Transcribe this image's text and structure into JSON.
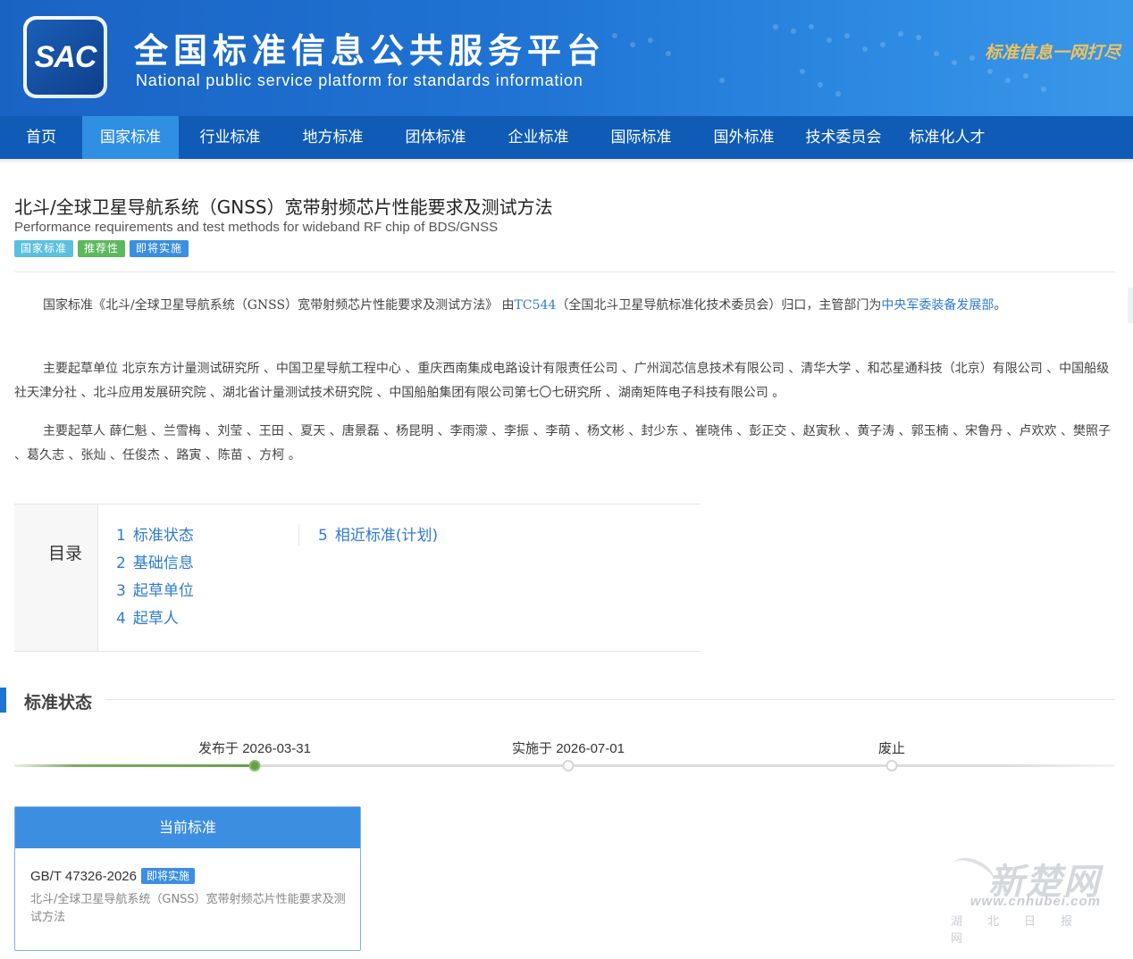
{
  "header": {
    "logo_text": "SAC",
    "title": "全国标准信息公共服务平台",
    "subtitle": "National public service platform  for standards information",
    "slogan": "标准信息一网打尽"
  },
  "nav": {
    "items": [
      {
        "label": "首页",
        "active": false
      },
      {
        "label": "国家标准",
        "active": true
      },
      {
        "label": "行业标准",
        "active": false
      },
      {
        "label": "地方标准",
        "active": false
      },
      {
        "label": "团体标准",
        "active": false
      },
      {
        "label": "企业标准",
        "active": false
      },
      {
        "label": "国际标准",
        "active": false
      },
      {
        "label": "国外标准",
        "active": false
      },
      {
        "label": "技术委员会",
        "active": false
      },
      {
        "label": "标准化人才",
        "active": false
      }
    ]
  },
  "standard": {
    "title": "北斗/全球卫星导航系统（GNSS）宽带射频芯片性能要求及测试方法",
    "title_en": "Performance requirements and test methods for wideband RF chip of BDS/GNSS",
    "tags": [
      "国家标准",
      "推荐性",
      "即将实施"
    ],
    "intro": {
      "prefix": "国家标准《北斗/全球卫星导航系统（GNSS）宽带射频芯片性能要求及测试方法》 由",
      "committee_link": "TC544",
      "middle": "（全国北斗卫星导航标准化技术委员会）归口，主管部门为",
      "dept_link": "中央军委装备发展部",
      "suffix": "。"
    },
    "drafting_units": "主要起草单位 北京东方计量测试研究所 、中国卫星导航工程中心 、重庆西南集成电路设计有限责任公司 、广州润芯信息技术有限公司 、清华大学 、和芯星通科技（北京）有限公司 、中国船级社天津分社 、北斗应用发展研究院 、湖北省计量测试技术研究院 、中国船舶集团有限公司第七〇七研究所 、湖南矩阵电子科技有限公司 。",
    "drafters": "主要起草人 薛仁魁 、兰雪梅 、刘莹 、王田 、夏天 、唐景磊 、杨昆明 、李雨濛 、李振 、李萌 、杨文彬 、封少东 、崔晓伟 、彭正交 、赵寅秋 、黄子涛 、郭玉楠 、宋鲁丹 、卢欢欢 、樊照子 、葛久志 、张灿 、任俊杰 、路寅 、陈苗 、方柯 。"
  },
  "toc": {
    "label": "目录",
    "col1": [
      {
        "num": "1",
        "label": "标准状态"
      },
      {
        "num": "2",
        "label": "基础信息"
      },
      {
        "num": "3",
        "label": "起草单位"
      },
      {
        "num": "4",
        "label": "起草人"
      }
    ],
    "col2": [
      {
        "num": "5",
        "label": "相近标准(计划)"
      }
    ]
  },
  "status_section": {
    "title": "标准状态",
    "timeline": [
      {
        "label": "发布于 2026-03-31",
        "done": true
      },
      {
        "label": "实施于 2026-07-01",
        "done": false
      },
      {
        "label": "废止",
        "done": false
      }
    ],
    "progress_fraction": 0.217
  },
  "current_card": {
    "header": "当前标准",
    "code": "GB/T 47326-2026",
    "badge": "即将实施",
    "desc": "北斗/全球卫星导航系统（GNSS）宽带射频芯片性能要求及测试方法"
  },
  "watermark": {
    "main": "新楚网",
    "url": "www.cnhubei.com",
    "sub": "湖北日报网"
  },
  "colors": {
    "brand_blue": "#1f73d3",
    "nav_bg": "#0f5bb5",
    "nav_active": "#2f8fe3",
    "link": "#2e7bd1",
    "progress_green": "#67a04c"
  }
}
